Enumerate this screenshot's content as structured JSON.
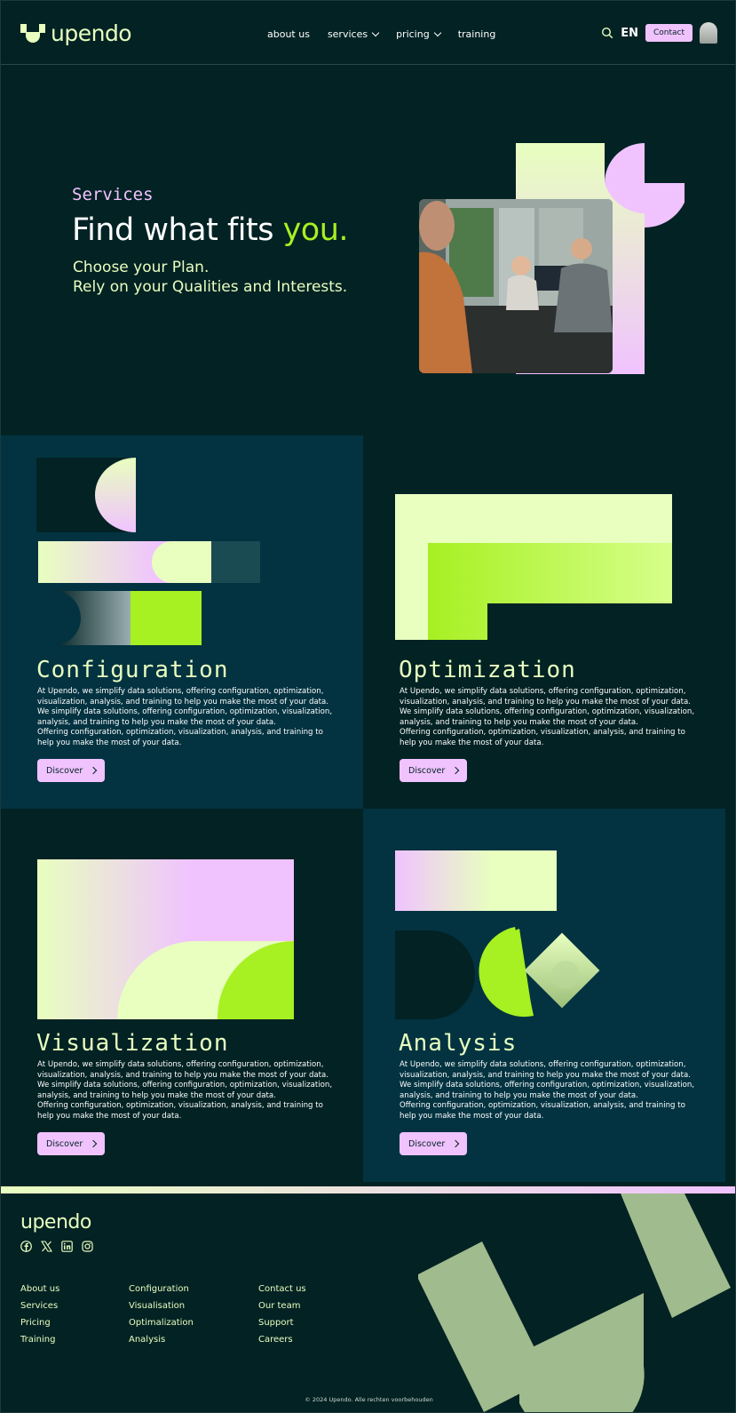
{
  "header": {
    "logo_text": "upendo",
    "nav": [
      {
        "label": "about us",
        "has_dropdown": false
      },
      {
        "label": "services",
        "has_dropdown": true
      },
      {
        "label": "pricing",
        "has_dropdown": true
      },
      {
        "label": "training",
        "has_dropdown": false
      }
    ],
    "language": "EN",
    "contact_label": "Contact"
  },
  "hero": {
    "eyebrow": "Services",
    "title_main": "Find what fits ",
    "title_accent": "you.",
    "subtitle_line1": "Choose your Plan.",
    "subtitle_line2": "Rely on your Qualities and Interests."
  },
  "cards": [
    {
      "title": "Configuration",
      "text1": "At Upendo, we simplify data solutions, offering configuration, optimization, visualization, analysis, and training to help you make the most of your data.",
      "text2": "We simplify data solutions, offering configuration, optimization, visualization, analysis, and training to help you make the most of your data.",
      "text3": "Offering configuration, optimization, visualization, analysis, and training to help you make the most of your data.",
      "button": "Discover"
    },
    {
      "title": "Optimization",
      "text1": "At Upendo, we simplify data solutions, offering configuration, optimization, visualization, analysis, and training to help you make the most of your data.",
      "text2": "We simplify data solutions, offering configuration, optimization, visualization, analysis, and training to help you make the most of your data.",
      "text3": "Offering configuration, optimization, visualization, analysis, and training to help you make the most of your data.",
      "button": "Discover"
    },
    {
      "title": "Visualization",
      "text1": "At Upendo, we simplify data solutions, offering configuration, optimization, visualization, analysis, and training to help you make the most of your data.",
      "text2": "We simplify data solutions, offering configuration, optimization, visualization, analysis, and training to help you make the most of your data.",
      "text3": "Offering configuration, optimization, visualization, analysis, and training to help you make the most of your data.",
      "button": "Discover"
    },
    {
      "title": "Analysis",
      "text1": "At Upendo, we simplify data solutions, offering configuration, optimization, visualization, analysis, and training to help you make the most of your data.",
      "text2": "We simplify data solutions, offering configuration, optimization, visualization, analysis, and training to help you make the most of your data.",
      "text3": "Offering configuration, optimization, visualization, analysis, and training to help you make the most of your data.",
      "button": "Discover"
    }
  ],
  "footer": {
    "logo_text": "upendo",
    "socials": [
      "facebook-icon",
      "x-icon",
      "linkedin-icon",
      "instagram-icon"
    ],
    "col1": [
      "About us",
      "Services",
      "Pricing",
      "Training"
    ],
    "col2": [
      "Configuration",
      "Visualisation",
      "Optimalization",
      "Analysis"
    ],
    "col3": [
      "Contact us",
      "Our team",
      "Support",
      "Careers"
    ],
    "copyright": "© 2024 Upendo. Alle rechten voorbehouden"
  },
  "colors": {
    "background": "#032224",
    "panel": "#033341",
    "lime": "#a7f022",
    "cream": "#e8ffbf",
    "pink": "#f0c3ff",
    "sage": "#a0bb8d"
  }
}
